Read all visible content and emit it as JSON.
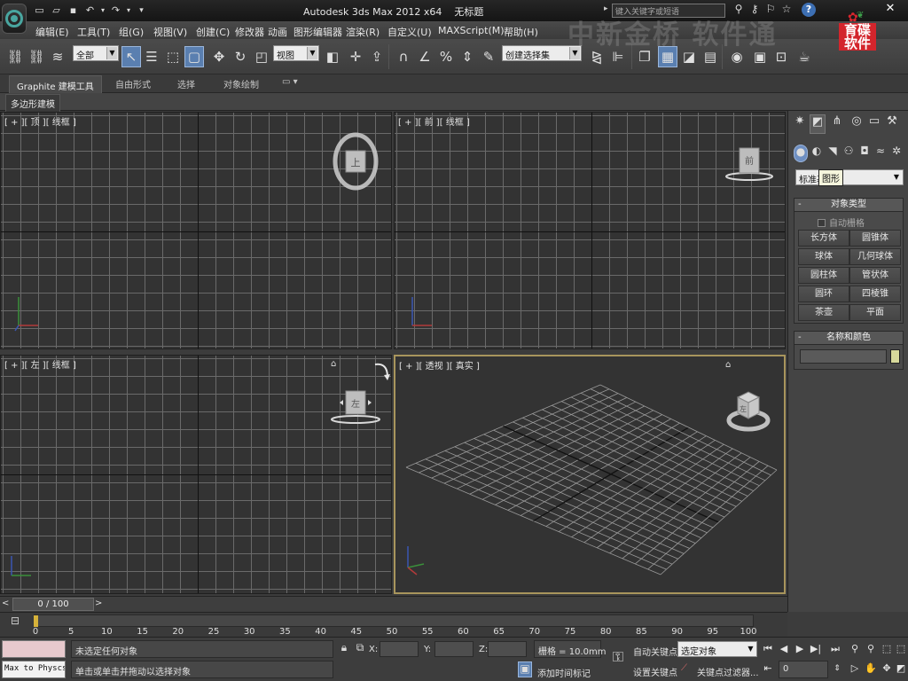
{
  "titlebar": {
    "app_title": "Autodesk 3ds Max  2012 x64",
    "document": "无标题",
    "search_placeholder": "键入关键字或短语"
  },
  "watermark": {
    "text": "中新金桥 软件通",
    "logo_line1": "育碟",
    "logo_line2": "软件"
  },
  "menu": [
    "编辑(E)",
    "工具(T)",
    "组(G)",
    "视图(V)",
    "创建(C)",
    "修改器",
    "动画",
    "图形编辑器",
    "渲染(R)",
    "自定义(U)",
    "MAXScript(M)",
    "帮助(H)"
  ],
  "toolbar": {
    "selection_filter": "全部",
    "reference_coord": "视图",
    "named_selection_set": "创建选择集"
  },
  "ribbon": {
    "tabs": [
      "Graphite 建模工具",
      "自由形式",
      "选择",
      "对象绘制"
    ],
    "panel_label": "多边形建模"
  },
  "viewports": {
    "top": {
      "label": "[ + ][ 顶 ][ 线框 ]",
      "cube": "上"
    },
    "front": {
      "label": "[ + ][ 前 ][ 线框 ]",
      "cube": "前"
    },
    "left": {
      "label": "[ + ][ 左 ][ 线框 ]",
      "cube": "左"
    },
    "perspective": {
      "label": "[ + ][ 透视 ][ 真实 ]",
      "cube": "左"
    }
  },
  "command_panel": {
    "category": "标准基本体",
    "tooltip": "图形",
    "object_type": {
      "title": "对象类型",
      "autogrid": "自动栅格",
      "buttons": [
        "长方体",
        "圆锥体",
        "球体",
        "几何球体",
        "圆柱体",
        "管状体",
        "圆环",
        "四棱锥",
        "茶壶",
        "平面"
      ]
    },
    "name_color": {
      "title": "名称和颜色",
      "color": "#d7d99b"
    }
  },
  "timeline": {
    "frame_display": "0 / 100",
    "ticks": [
      0,
      5,
      10,
      15,
      20,
      25,
      30,
      35,
      40,
      45,
      50,
      55,
      60,
      65,
      70,
      75,
      80,
      85,
      90,
      95,
      100
    ]
  },
  "status": {
    "listener_text": "Max to Physcs (",
    "selection_status": "未选定任何对象",
    "prompt": "单击或单击并拖动以选择对象",
    "x_label": "X:",
    "y_label": "Y:",
    "z_label": "Z:",
    "grid": "栅格 = 10.0mm",
    "add_time_tag": "添加时间标记",
    "auto_key": "自动关键点",
    "auto_key_dropdown": "选定对象",
    "set_key": "设置关键点",
    "key_filters": "关键点过滤器...",
    "current_frame": "0"
  }
}
